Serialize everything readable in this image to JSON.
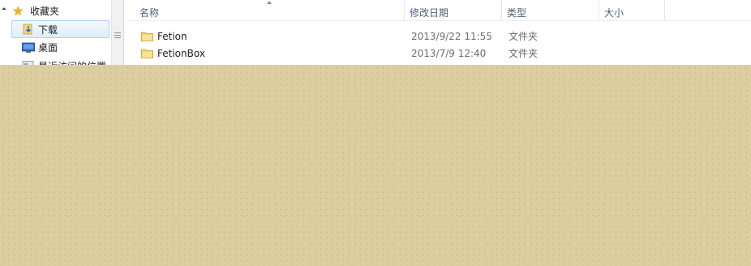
{
  "nav": {
    "favorites_label": "收藏夹",
    "items": [
      {
        "label": "下载",
        "icon": "download-folder-icon",
        "selected": true
      },
      {
        "label": "桌面",
        "icon": "desktop-icon"
      },
      {
        "label": "最近访问的位置",
        "icon": "recent-places-icon"
      }
    ]
  },
  "list": {
    "columns": [
      "名称",
      "修改日期",
      "类型",
      "大小"
    ],
    "rows": [
      {
        "name": "Fetion",
        "date": "2013/9/22 11:55",
        "type": "文件夹"
      },
      {
        "name": "FetionBox",
        "date": "2013/7/9 12:40",
        "type": "文件夹"
      },
      {
        "name": "",
        "date": "",
        "type": ""
      }
    ]
  },
  "colors": {
    "overlay": "#dcce9e",
    "selection": "#dfedfb",
    "header_text": "#4c607a"
  }
}
